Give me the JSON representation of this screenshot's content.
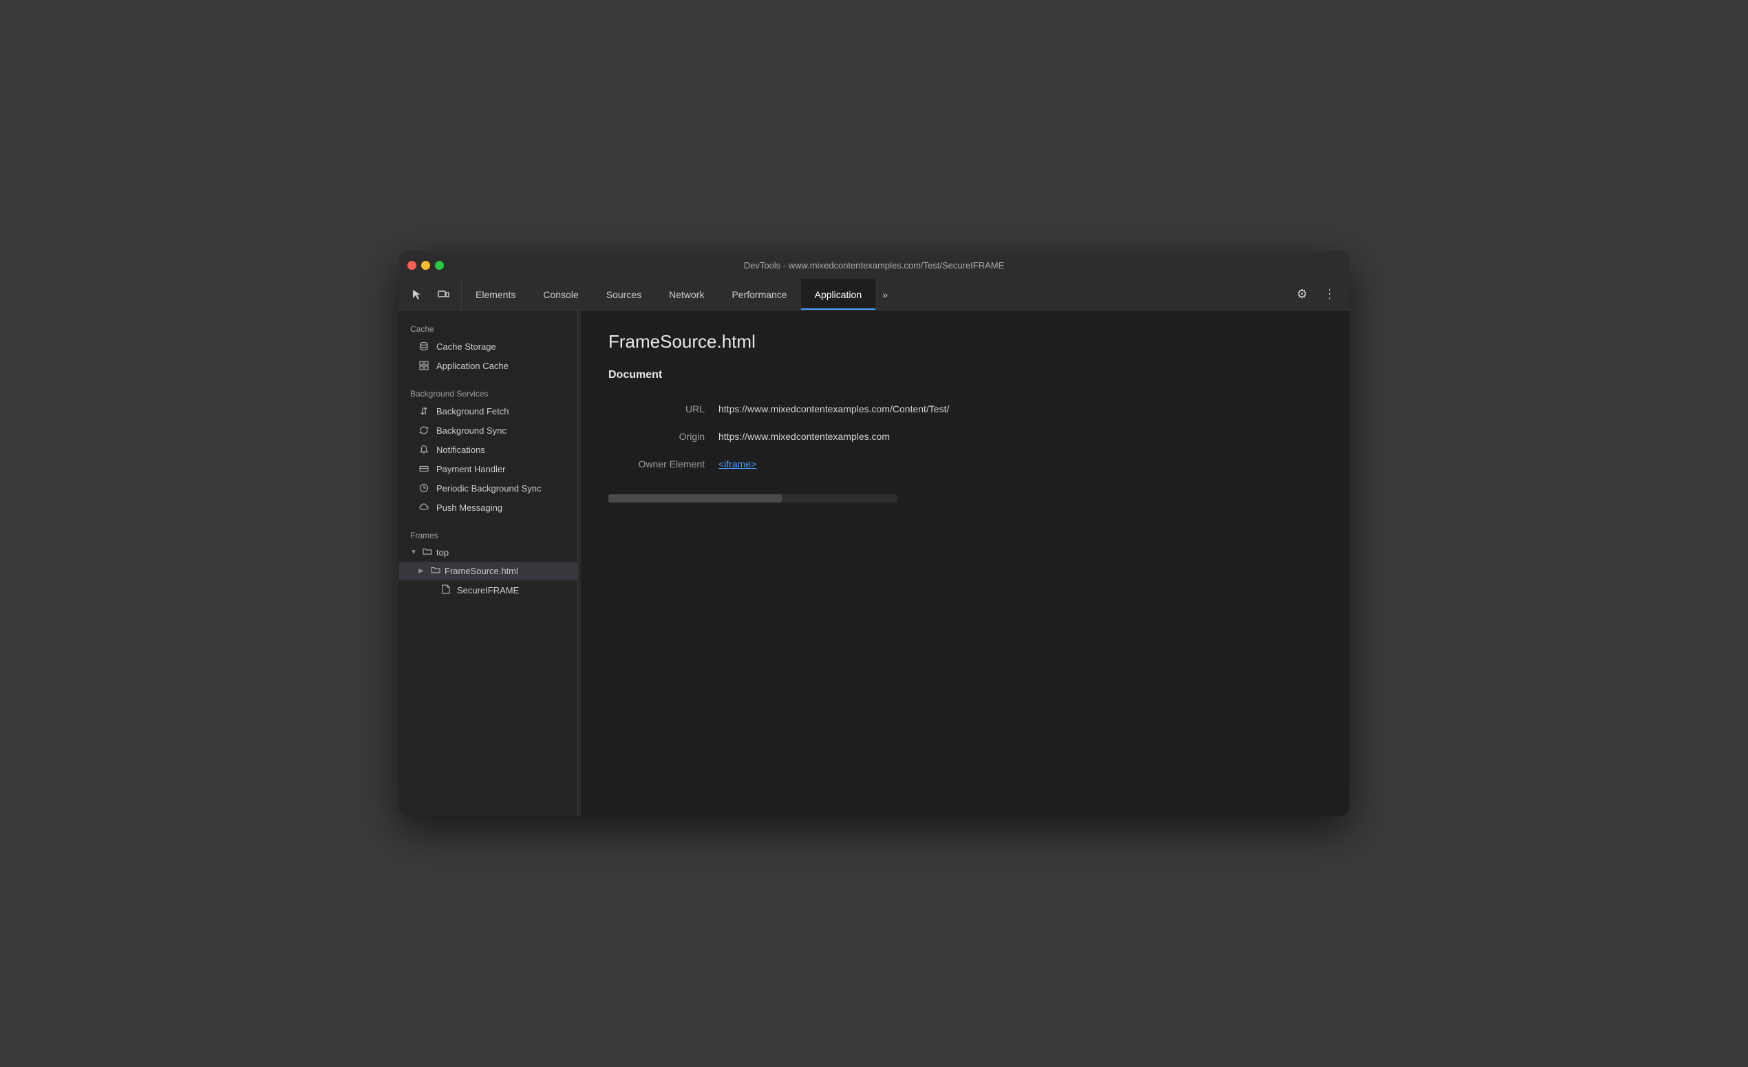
{
  "window": {
    "title": "DevTools - www.mixedcontentexamples.com/Test/SecureIFRAME"
  },
  "toolbar": {
    "icons": [
      {
        "name": "cursor-icon",
        "symbol": "↖"
      },
      {
        "name": "device-icon",
        "symbol": "⬜"
      }
    ],
    "tabs": [
      {
        "id": "elements",
        "label": "Elements",
        "active": false
      },
      {
        "id": "console",
        "label": "Console",
        "active": false
      },
      {
        "id": "sources",
        "label": "Sources",
        "active": false
      },
      {
        "id": "network",
        "label": "Network",
        "active": false
      },
      {
        "id": "performance",
        "label": "Performance",
        "active": false
      },
      {
        "id": "application",
        "label": "Application",
        "active": true
      }
    ],
    "more_label": "»",
    "settings_icon": "⚙",
    "menu_icon": "⋮"
  },
  "sidebar": {
    "sections": [
      {
        "id": "cache",
        "label": "Cache",
        "items": [
          {
            "id": "cache-storage",
            "label": "Cache Storage",
            "icon": "🗄"
          },
          {
            "id": "application-cache",
            "label": "Application Cache",
            "icon": "⊞"
          }
        ]
      },
      {
        "id": "background-services",
        "label": "Background Services",
        "items": [
          {
            "id": "background-fetch",
            "label": "Background Fetch",
            "icon": "↕"
          },
          {
            "id": "background-sync",
            "label": "Background Sync",
            "icon": "↻"
          },
          {
            "id": "notifications",
            "label": "Notifications",
            "icon": "🔔"
          },
          {
            "id": "payment-handler",
            "label": "Payment Handler",
            "icon": "▬"
          },
          {
            "id": "periodic-background-sync",
            "label": "Periodic Background Sync",
            "icon": "🕐"
          },
          {
            "id": "push-messaging",
            "label": "Push Messaging",
            "icon": "☁"
          }
        ]
      },
      {
        "id": "frames",
        "label": "Frames"
      }
    ],
    "frames": {
      "top": {
        "label": "top",
        "children": [
          {
            "id": "framesource",
            "label": "FrameSource.html",
            "active": true,
            "children": [
              {
                "id": "secureiframe",
                "label": "SecureIFRAME"
              }
            ]
          }
        ]
      }
    }
  },
  "main": {
    "page_title": "FrameSource.html",
    "section_heading": "Document",
    "fields": [
      {
        "label": "URL",
        "value": "https://www.mixedcontentexamples.com/Content/Test/",
        "is_link": false
      },
      {
        "label": "Origin",
        "value": "https://www.mixedcontentexamples.com",
        "is_link": false
      },
      {
        "label": "Owner Element",
        "value": "<iframe>",
        "is_link": true
      }
    ]
  }
}
